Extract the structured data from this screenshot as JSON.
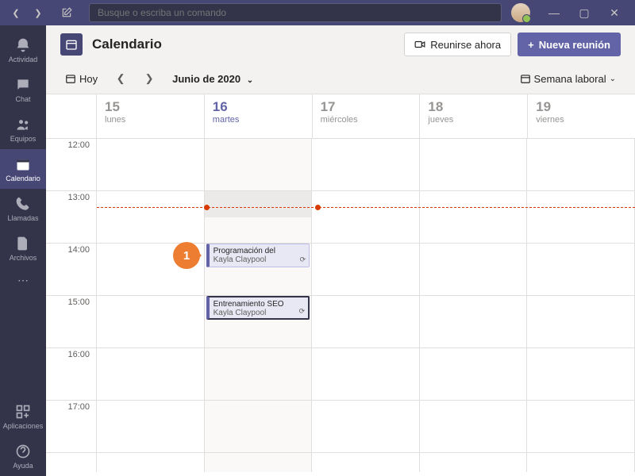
{
  "search": {
    "placeholder": "Busque o escriba un comando"
  },
  "rail": {
    "items": [
      {
        "label": "Actividad"
      },
      {
        "label": "Chat"
      },
      {
        "label": "Equipos"
      },
      {
        "label": "Calendario"
      },
      {
        "label": "Llamadas"
      },
      {
        "label": "Archivos"
      }
    ],
    "apps": "Aplicaciones",
    "help": "Ayuda"
  },
  "header": {
    "title": "Calendario",
    "meet_now": "Reunirse ahora",
    "new_meeting": "Nueva reunión"
  },
  "toolbar": {
    "today": "Hoy",
    "month": "Junio de 2020",
    "view": "Semana laboral"
  },
  "days": [
    {
      "num": "15",
      "name": "lunes"
    },
    {
      "num": "16",
      "name": "martes"
    },
    {
      "num": "17",
      "name": "miércoles"
    },
    {
      "num": "18",
      "name": "jueves"
    },
    {
      "num": "19",
      "name": "viernes"
    }
  ],
  "hours": [
    "12:00",
    "13:00",
    "14:00",
    "15:00",
    "16:00",
    "17:00"
  ],
  "events": [
    {
      "title": "Programación del",
      "organizer": "Kayla Claypool"
    },
    {
      "title": "Entrenamiento SEO",
      "organizer": "Kayla Claypool"
    }
  ],
  "callout": {
    "num": "1"
  }
}
